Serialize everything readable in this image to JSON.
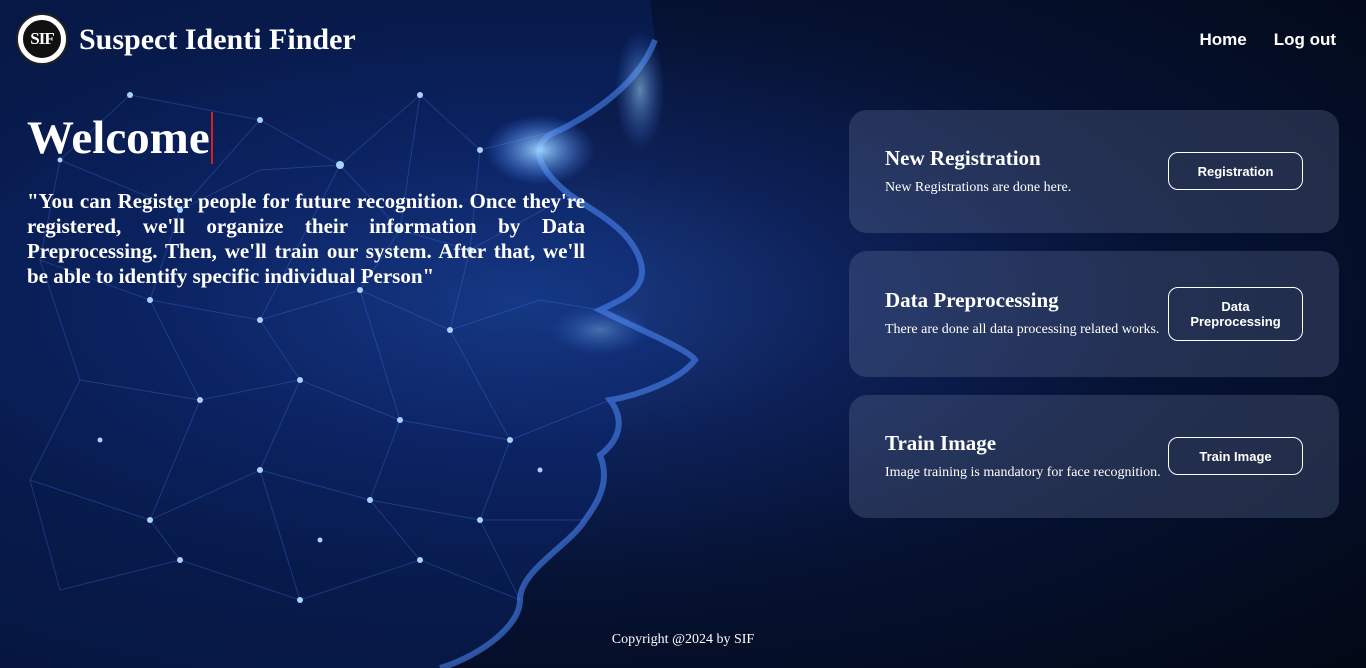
{
  "header": {
    "logo_text": "SIF",
    "title": "Suspect Identi Finder",
    "nav": [
      "Home",
      "Log out"
    ]
  },
  "hero": {
    "welcome": "Welcome",
    "intro": "\"You can Register people for future recognition. Once they're registered, we'll organize their information by Data Preprocessing. Then, we'll train our system. After that, we'll be able to identify specific individual Person\""
  },
  "cards": [
    {
      "title": "New Registration",
      "description": "New Registrations are done here.",
      "button": "Registration"
    },
    {
      "title": "Data Preprocessing",
      "description": "There are done all data processing related works.",
      "button": "Data Preprocessing"
    },
    {
      "title": "Train Image",
      "description": "Image training is mandatory for face recognition.",
      "button": "Train Image"
    }
  ],
  "footer": {
    "copyright": "Copyright @2024 by SIF"
  },
  "colors": {
    "background": "#061233",
    "accent_glow": "#1c3f8a",
    "cursor": "#d42020",
    "card": "#3a4560"
  },
  "icons": {
    "logo": "sif-seal-logo"
  }
}
